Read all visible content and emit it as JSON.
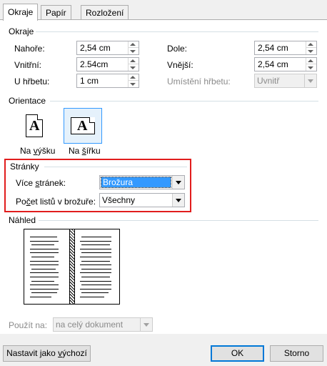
{
  "tabs": [
    {
      "label": "Okraje",
      "active": true
    },
    {
      "label": "Papír",
      "active": false
    },
    {
      "label": "Rozložení",
      "active": false
    }
  ],
  "margins": {
    "section_title": "Okraje",
    "top": {
      "label": "Nahoře:",
      "value": "2,54 cm"
    },
    "bottom": {
      "label": "Dole:",
      "value": "2,54 cm"
    },
    "inside": {
      "label": "Vnitřní:",
      "value": "2.54cm"
    },
    "outside": {
      "label": "Vnější:",
      "value": "2,54 cm"
    },
    "gutter": {
      "label": "U hřbetu:",
      "value": "1 cm"
    },
    "gutter_position": {
      "label": "Umístění hřbetu:",
      "value": "Uvnitř",
      "disabled": true
    }
  },
  "orientation": {
    "section_title": "Orientace",
    "portrait": {
      "label": "Na výšku",
      "glyph": "A",
      "selected": false
    },
    "landscape": {
      "label": "Na šířku",
      "glyph": "A",
      "selected": true
    }
  },
  "pages": {
    "section_title": "Stránky",
    "multiple_pages": {
      "label": "Více stránek:",
      "value": "Brožura"
    },
    "sheets_per_booklet": {
      "label": "Počet listů v brožuře:",
      "value": "Všechny"
    },
    "highlight_color": "#e11d1d"
  },
  "preview": {
    "section_title": "Náhled"
  },
  "apply_to": {
    "label": "Použít na:",
    "value": "na celý dokument",
    "disabled": true
  },
  "buttons": {
    "set_default": "Nastavit jako výchozí",
    "ok": "OK",
    "cancel": "Storno"
  },
  "colors": {
    "accent": "#3399ff",
    "highlight_border": "#e11d1d",
    "panel_bg": "#ffffff",
    "dialog_bg": "#f0f0f0"
  }
}
